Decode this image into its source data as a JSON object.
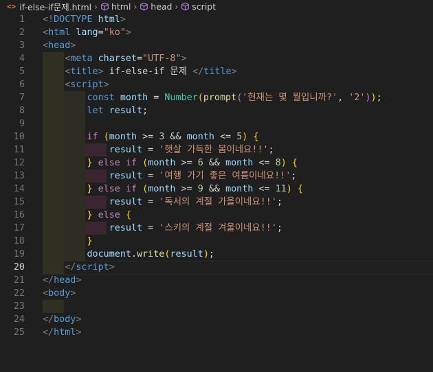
{
  "breadcrumb": {
    "file_icon": "<>",
    "file": "if-else-if문제.html",
    "items": [
      "html",
      "head",
      "script"
    ]
  },
  "line_numbers": [
    "1",
    "2",
    "3",
    "4",
    "5",
    "6",
    "7",
    "8",
    "9",
    "10",
    "11",
    "12",
    "13",
    "14",
    "15",
    "16",
    "17",
    "18",
    "19",
    "20",
    "21",
    "22",
    "23",
    "24",
    "25"
  ],
  "active_line": 20,
  "code": [
    [
      [
        "t-bracket",
        "<!"
      ],
      [
        "t-tag",
        "DOCTYPE"
      ],
      [
        "t-plain",
        " "
      ],
      [
        "t-attr",
        "html"
      ],
      [
        "t-bracket",
        ">"
      ]
    ],
    [
      [
        "t-bracket",
        "<"
      ],
      [
        "t-tag",
        "html"
      ],
      [
        "t-plain",
        " "
      ],
      [
        "t-attr",
        "lang"
      ],
      [
        "t-plain",
        "="
      ],
      [
        "t-str",
        "\"ko\""
      ],
      [
        "t-bracket",
        ">"
      ]
    ],
    [
      [
        "t-bracket",
        "<"
      ],
      [
        "t-tag",
        "head"
      ],
      [
        "t-bracket",
        ">"
      ]
    ],
    [
      [
        "t-plain",
        "    "
      ],
      [
        "t-bracket",
        "<"
      ],
      [
        "t-tag",
        "meta"
      ],
      [
        "t-plain",
        " "
      ],
      [
        "t-attr",
        "charset"
      ],
      [
        "t-plain",
        "="
      ],
      [
        "t-str",
        "\"UTF-8\""
      ],
      [
        "t-bracket",
        ">"
      ]
    ],
    [
      [
        "t-plain",
        "    "
      ],
      [
        "t-bracket",
        "<"
      ],
      [
        "t-tag",
        "title"
      ],
      [
        "t-bracket",
        ">"
      ],
      [
        "t-plain",
        " if-else-if 문제 "
      ],
      [
        "t-bracket",
        "</"
      ],
      [
        "t-tag",
        "title"
      ],
      [
        "t-bracket",
        ">"
      ]
    ],
    [
      [
        "t-plain",
        "    "
      ],
      [
        "t-bracket",
        "<"
      ],
      [
        "t-tag",
        "script"
      ],
      [
        "t-bracket",
        ">"
      ]
    ],
    [
      [
        "t-plain",
        "        "
      ],
      [
        "t-kw",
        "const"
      ],
      [
        "t-plain",
        " "
      ],
      [
        "t-var",
        "month"
      ],
      [
        "t-plain",
        " = "
      ],
      [
        "t-class",
        "Number"
      ],
      [
        "t-b1",
        "("
      ],
      [
        "t-func",
        "prompt"
      ],
      [
        "t-b2",
        "("
      ],
      [
        "t-str",
        "'현재는 몇 월입니까?'"
      ],
      [
        "t-plain",
        ", "
      ],
      [
        "t-str",
        "'2'"
      ],
      [
        "t-b2",
        ")"
      ],
      [
        "t-b1",
        ")"
      ],
      [
        "t-plain",
        ";"
      ]
    ],
    [
      [
        "t-plain",
        "        "
      ],
      [
        "t-kw",
        "let"
      ],
      [
        "t-plain",
        " "
      ],
      [
        "t-var",
        "result"
      ],
      [
        "t-plain",
        ";"
      ]
    ],
    [
      [
        "t-plain",
        ""
      ]
    ],
    [
      [
        "t-plain",
        "        "
      ],
      [
        "t-ctrl",
        "if"
      ],
      [
        "t-plain",
        " "
      ],
      [
        "t-b1",
        "("
      ],
      [
        "t-var",
        "month"
      ],
      [
        "t-plain",
        " >= "
      ],
      [
        "t-num",
        "3"
      ],
      [
        "t-plain",
        " && "
      ],
      [
        "t-var",
        "month"
      ],
      [
        "t-plain",
        " <= "
      ],
      [
        "t-num",
        "5"
      ],
      [
        "t-b1",
        ")"
      ],
      [
        "t-plain",
        " "
      ],
      [
        "t-b1",
        "{"
      ]
    ],
    [
      [
        "t-plain",
        "            "
      ],
      [
        "t-var",
        "result"
      ],
      [
        "t-plain",
        " = "
      ],
      [
        "t-str",
        "'햇살 가득한 봄이네요!!'"
      ],
      [
        "t-plain",
        ";"
      ]
    ],
    [
      [
        "t-plain",
        "        "
      ],
      [
        "t-b1",
        "}"
      ],
      [
        "t-plain",
        " "
      ],
      [
        "t-ctrl",
        "else"
      ],
      [
        "t-plain",
        " "
      ],
      [
        "t-ctrl",
        "if"
      ],
      [
        "t-plain",
        " "
      ],
      [
        "t-b1",
        "("
      ],
      [
        "t-var",
        "month"
      ],
      [
        "t-plain",
        " >= "
      ],
      [
        "t-num",
        "6"
      ],
      [
        "t-plain",
        " && "
      ],
      [
        "t-var",
        "month"
      ],
      [
        "t-plain",
        " <= "
      ],
      [
        "t-num",
        "8"
      ],
      [
        "t-b1",
        ")"
      ],
      [
        "t-plain",
        " "
      ],
      [
        "t-b1",
        "{"
      ]
    ],
    [
      [
        "t-plain",
        "            "
      ],
      [
        "t-var",
        "result"
      ],
      [
        "t-plain",
        " = "
      ],
      [
        "t-str",
        "'여행 가기 좋은 여름이네요!!'"
      ],
      [
        "t-plain",
        ";"
      ]
    ],
    [
      [
        "t-plain",
        "        "
      ],
      [
        "t-b1",
        "}"
      ],
      [
        "t-plain",
        " "
      ],
      [
        "t-ctrl",
        "else"
      ],
      [
        "t-plain",
        " "
      ],
      [
        "t-ctrl",
        "if"
      ],
      [
        "t-plain",
        " "
      ],
      [
        "t-b1",
        "("
      ],
      [
        "t-var",
        "month"
      ],
      [
        "t-plain",
        " >= "
      ],
      [
        "t-num",
        "9"
      ],
      [
        "t-plain",
        " && "
      ],
      [
        "t-var",
        "month"
      ],
      [
        "t-plain",
        " <= "
      ],
      [
        "t-num",
        "11"
      ],
      [
        "t-b1",
        ")"
      ],
      [
        "t-plain",
        " "
      ],
      [
        "t-b1",
        "{"
      ]
    ],
    [
      [
        "t-plain",
        "            "
      ],
      [
        "t-var",
        "result"
      ],
      [
        "t-plain",
        " = "
      ],
      [
        "t-str",
        "'독서의 계절 가을이네요!!'"
      ],
      [
        "t-plain",
        ";"
      ]
    ],
    [
      [
        "t-plain",
        "        "
      ],
      [
        "t-b1",
        "}"
      ],
      [
        "t-plain",
        " "
      ],
      [
        "t-ctrl",
        "else"
      ],
      [
        "t-plain",
        " "
      ],
      [
        "t-b1",
        "{"
      ]
    ],
    [
      [
        "t-plain",
        "            "
      ],
      [
        "t-var",
        "result"
      ],
      [
        "t-plain",
        " = "
      ],
      [
        "t-str",
        "'스키의 계절 겨울이네요!!'"
      ],
      [
        "t-plain",
        ";"
      ]
    ],
    [
      [
        "t-plain",
        "        "
      ],
      [
        "t-b1",
        "}"
      ]
    ],
    [
      [
        "t-plain",
        "        "
      ],
      [
        "t-var",
        "document"
      ],
      [
        "t-plain",
        "."
      ],
      [
        "t-func",
        "write"
      ],
      [
        "t-b1",
        "("
      ],
      [
        "t-var",
        "result"
      ],
      [
        "t-b1",
        ")"
      ],
      [
        "t-plain",
        ";"
      ]
    ],
    [
      [
        "t-plain",
        "    "
      ],
      [
        "t-bracket",
        "</"
      ],
      [
        "t-tag",
        "script"
      ],
      [
        "t-bracket",
        ">"
      ]
    ],
    [
      [
        "t-bracket",
        "</"
      ],
      [
        "t-tag",
        "head"
      ],
      [
        "t-bracket",
        ">"
      ]
    ],
    [
      [
        "t-bracket",
        "<"
      ],
      [
        "t-tag",
        "body"
      ],
      [
        "t-bracket",
        ">"
      ]
    ],
    [
      [
        "t-plain",
        ""
      ]
    ],
    [
      [
        "t-bracket",
        "</"
      ],
      [
        "t-tag",
        "body"
      ],
      [
        "t-bracket",
        ">"
      ]
    ],
    [
      [
        "t-bracket",
        "</"
      ],
      [
        "t-tag",
        "html"
      ],
      [
        "t-bracket",
        ">"
      ]
    ]
  ],
  "indent_guides": [
    {
      "line": 4,
      "level": 1
    },
    {
      "line": 5,
      "level": 1
    },
    {
      "line": 6,
      "level": 1
    },
    {
      "line": 7,
      "level": 2
    },
    {
      "line": 8,
      "level": 2
    },
    {
      "line": 9,
      "level": 2
    },
    {
      "line": 10,
      "level": 2
    },
    {
      "line": 11,
      "level": 3
    },
    {
      "line": 12,
      "level": 2
    },
    {
      "line": 13,
      "level": 3
    },
    {
      "line": 14,
      "level": 2
    },
    {
      "line": 15,
      "level": 3
    },
    {
      "line": 16,
      "level": 2
    },
    {
      "line": 17,
      "level": 3
    },
    {
      "line": 18,
      "level": 2
    },
    {
      "line": 19,
      "level": 2
    },
    {
      "line": 20,
      "level": 1
    },
    {
      "line": 23,
      "level": 1
    }
  ],
  "colors": {
    "indent_guide_1": "#2f2f22",
    "indent_guide_2": "#2d2d24",
    "indent_guide_3": "#3a2530",
    "background": "#1f1f1f"
  }
}
